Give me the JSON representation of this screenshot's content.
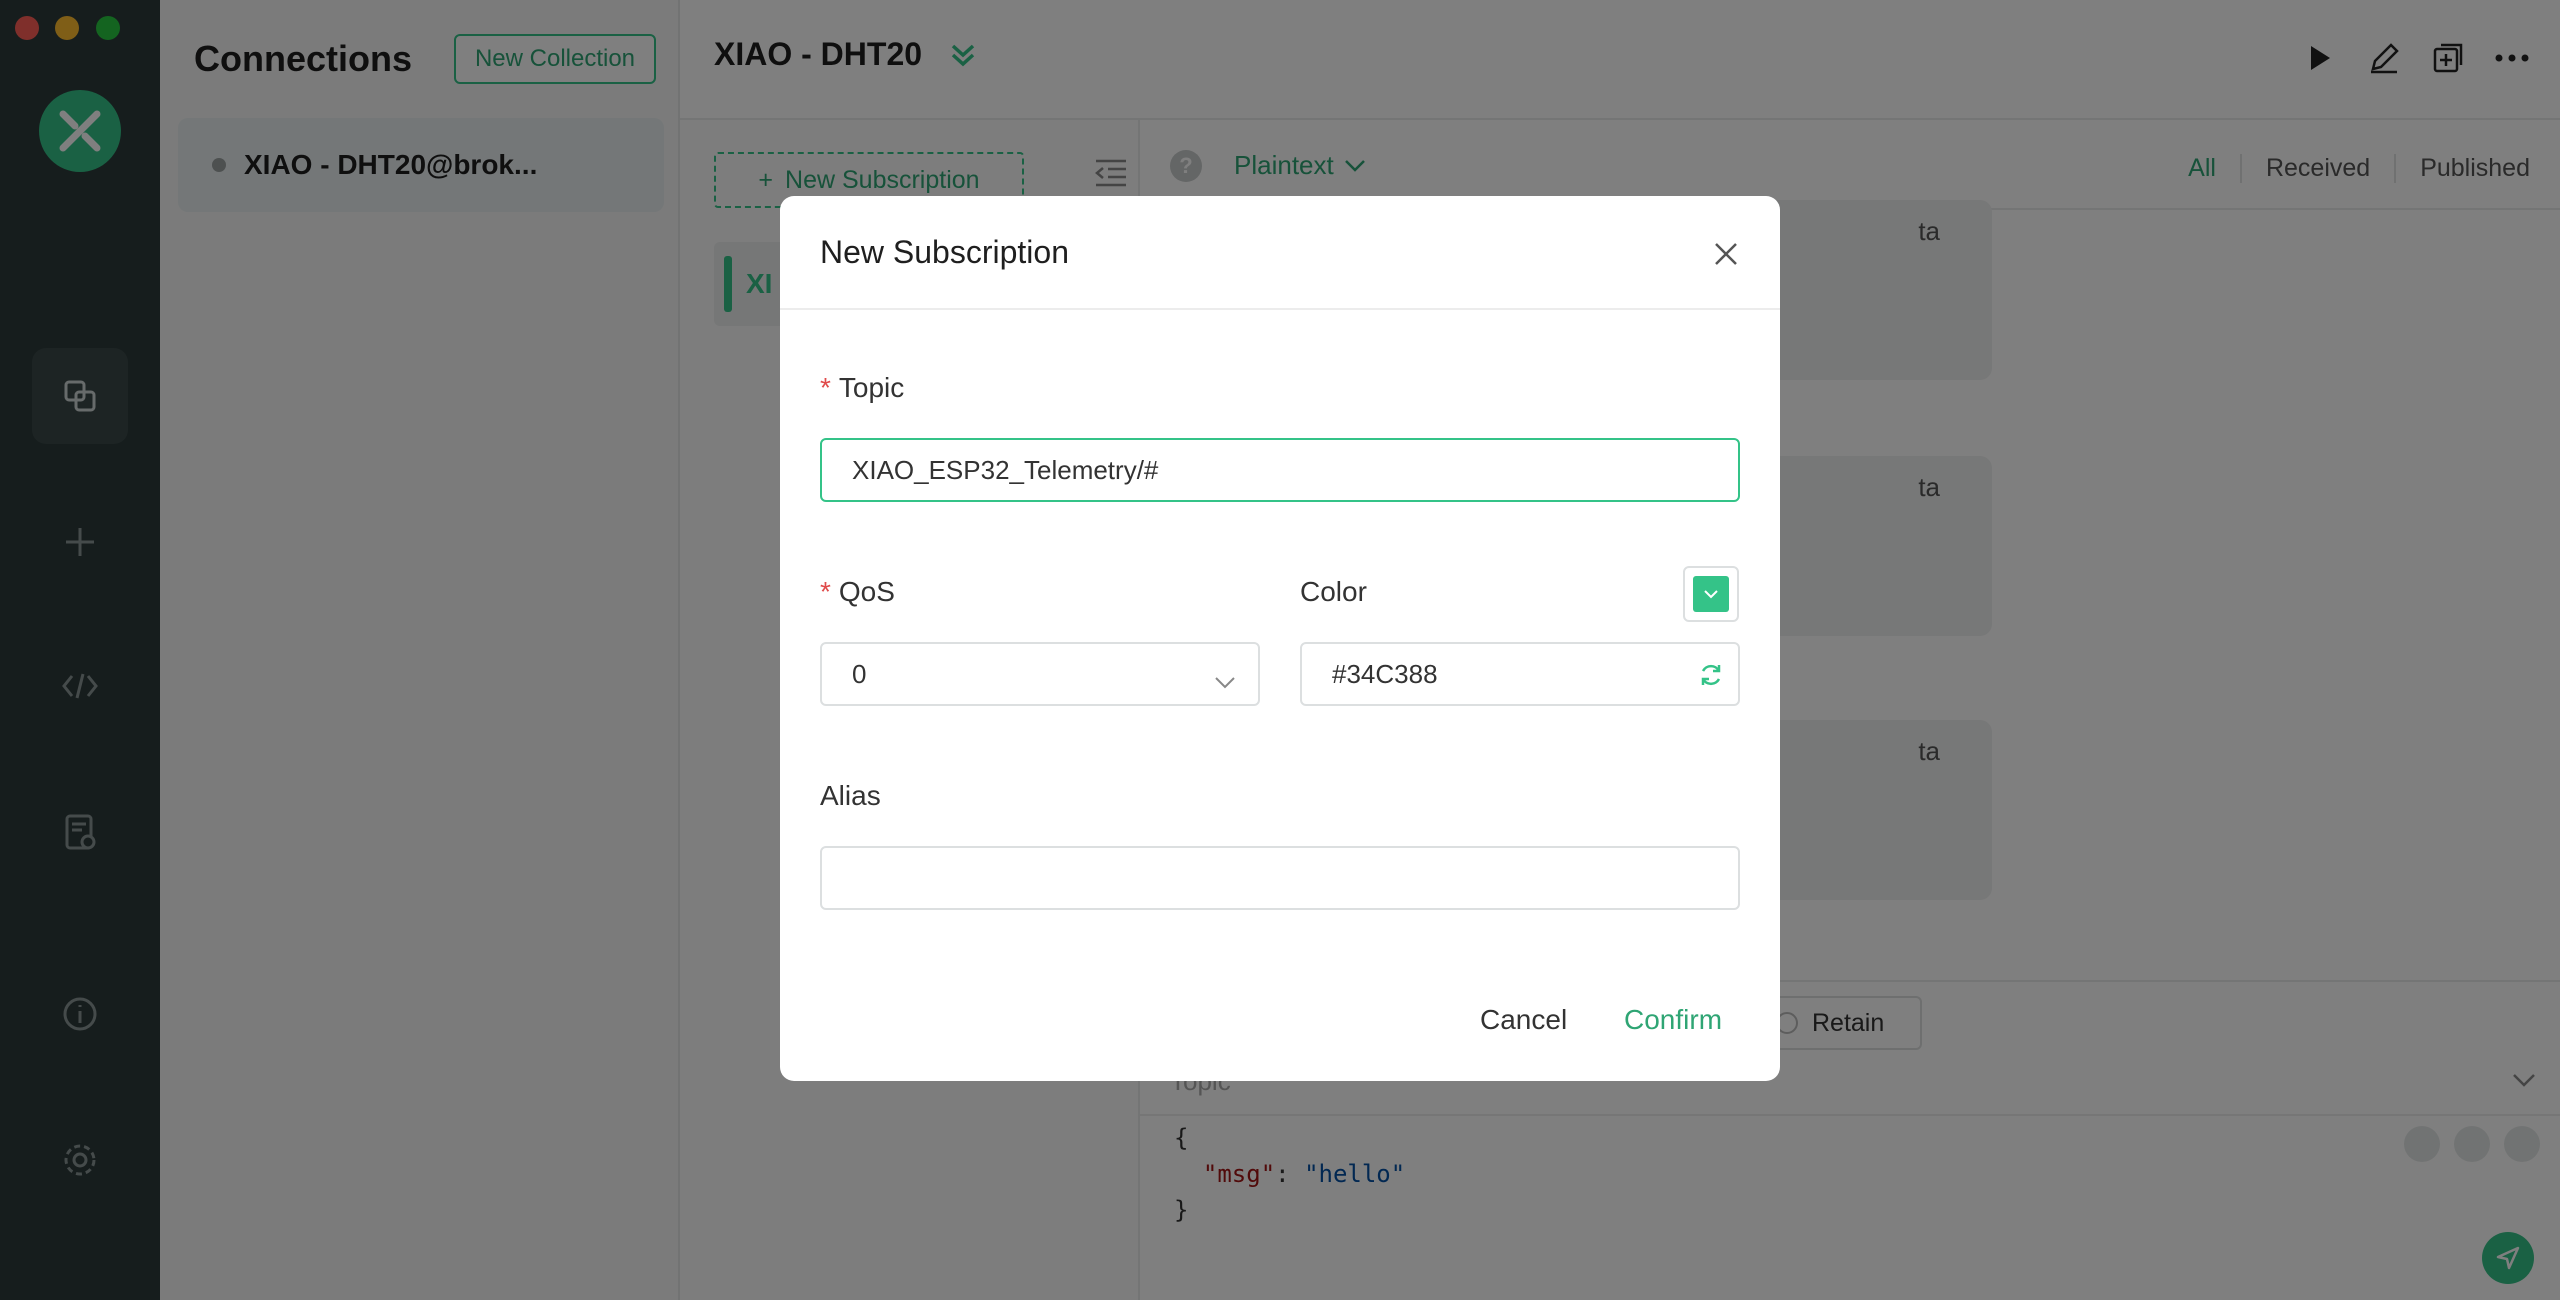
{
  "sidebar": {
    "title": "Connections",
    "new_collection_label": "New Collection",
    "connection_name": "XIAO - DHT20@brok..."
  },
  "main": {
    "title": "XIAO - DHT20",
    "new_subscription_label": "New Subscription",
    "subscription_peek": "XI",
    "payload_format": "Plaintext",
    "filters": [
      "All",
      "Received",
      "Published"
    ],
    "message_peek": "ta",
    "composer": {
      "retain_label": "Retain",
      "topic_placeholder": "Topic",
      "code_open": "{",
      "code_key": "\"msg\"",
      "code_colon": ": ",
      "code_value": "\"hello\"",
      "code_close": "}"
    }
  },
  "dialog": {
    "title": "New Subscription",
    "topic_label": "Topic",
    "topic_value": "XIAO_ESP32_Telemetry/#",
    "qos_label": "QoS",
    "qos_value": "0",
    "color_label": "Color",
    "color_value": "#34C388",
    "alias_label": "Alias",
    "alias_value": "",
    "cancel_label": "Cancel",
    "confirm_label": "Confirm"
  },
  "colors": {
    "accent": "#34c388",
    "required": "#e04b4b"
  }
}
